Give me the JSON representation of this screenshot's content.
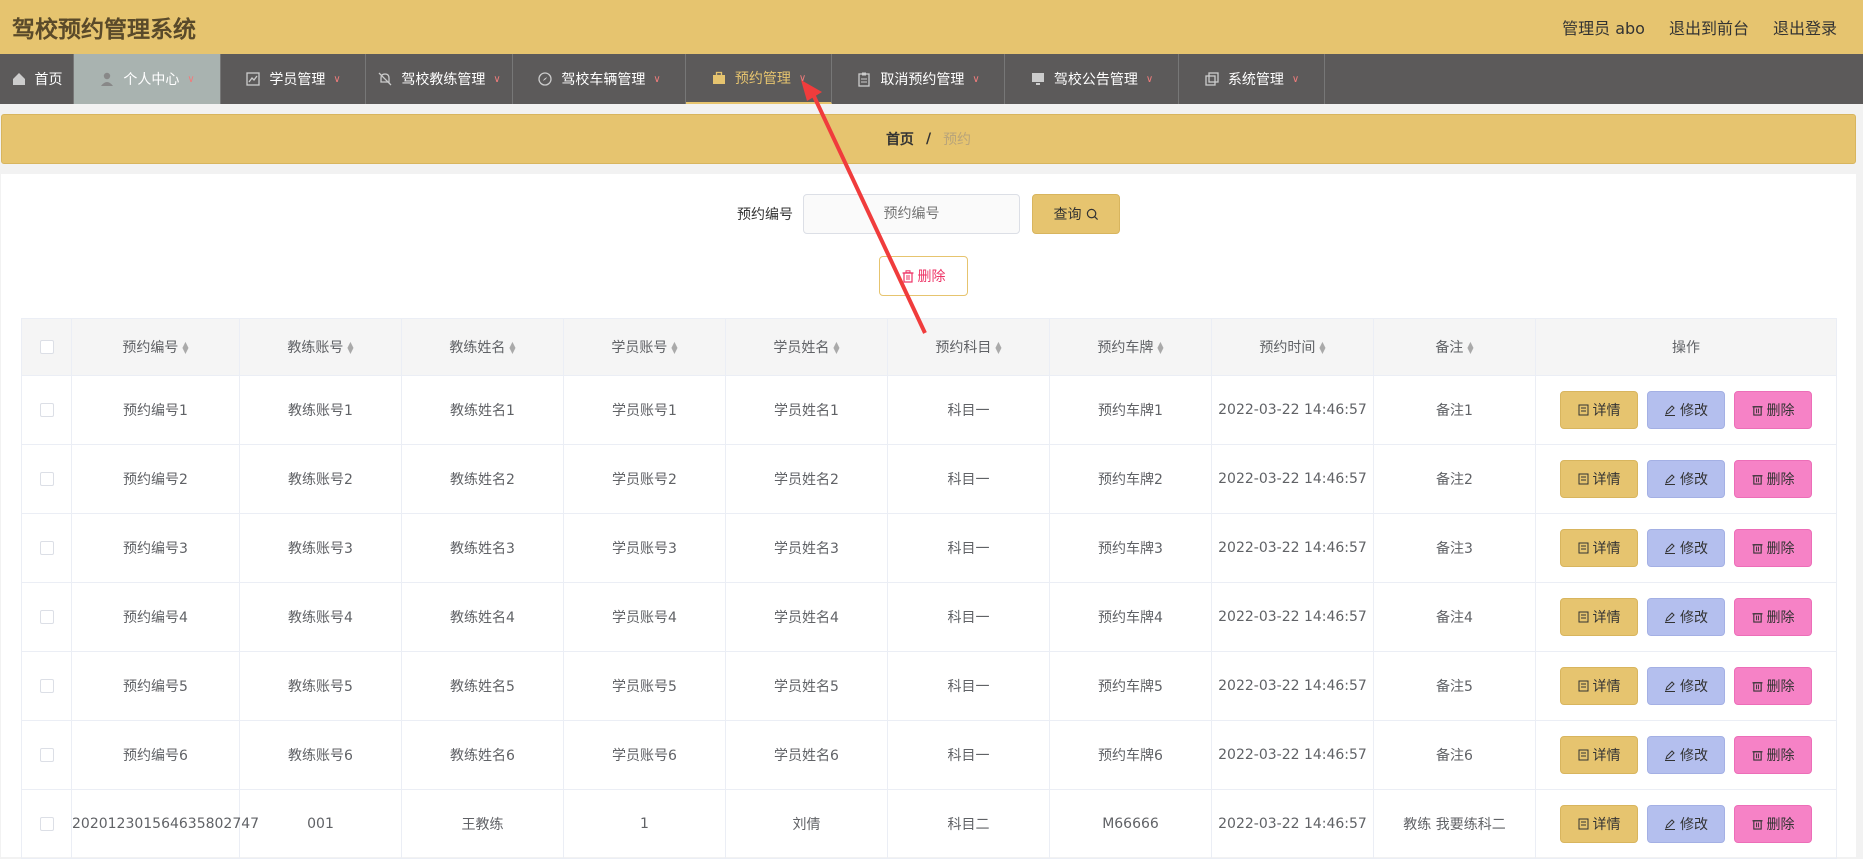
{
  "header": {
    "title": "驾校预约管理系统",
    "admin_label": "管理员 abo",
    "front_link": "退出到前台",
    "logout_link": "退出登录"
  },
  "nav": {
    "items": [
      {
        "label": "首页",
        "icon": "home-icon"
      },
      {
        "label": "个人中心",
        "icon": "user-icon"
      },
      {
        "label": "学员管理",
        "icon": "chart-icon"
      },
      {
        "label": "驾校教练管理",
        "icon": "bell-off-icon"
      },
      {
        "label": "驾校车辆管理",
        "icon": "compass-icon"
      },
      {
        "label": "预约管理",
        "icon": "briefcase-icon"
      },
      {
        "label": "取消预约管理",
        "icon": "clipboard-icon"
      },
      {
        "label": "驾校公告管理",
        "icon": "monitor-icon"
      },
      {
        "label": "系统管理",
        "icon": "copy-icon"
      }
    ],
    "active_index": 5,
    "accent": "#e6c46f"
  },
  "breadcrumb": {
    "home": "首页",
    "separator": "/",
    "current": "预约"
  },
  "search": {
    "label": "预约编号",
    "placeholder": "预约编号",
    "button": "查询"
  },
  "bulk_delete": "删除",
  "table": {
    "columns": [
      "预约编号",
      "教练账号",
      "教练姓名",
      "学员账号",
      "学员姓名",
      "预约科目",
      "预约车牌",
      "预约时间",
      "备注",
      "操作"
    ],
    "rows": [
      [
        "预约编号1",
        "教练账号1",
        "教练姓名1",
        "学员账号1",
        "学员姓名1",
        "科目一",
        "预约车牌1",
        "2022-03-22 14:46:57",
        "备注1"
      ],
      [
        "预约编号2",
        "教练账号2",
        "教练姓名2",
        "学员账号2",
        "学员姓名2",
        "科目一",
        "预约车牌2",
        "2022-03-22 14:46:57",
        "备注2"
      ],
      [
        "预约编号3",
        "教练账号3",
        "教练姓名3",
        "学员账号3",
        "学员姓名3",
        "科目一",
        "预约车牌3",
        "2022-03-22 14:46:57",
        "备注3"
      ],
      [
        "预约编号4",
        "教练账号4",
        "教练姓名4",
        "学员账号4",
        "学员姓名4",
        "科目一",
        "预约车牌4",
        "2022-03-22 14:46:57",
        "备注4"
      ],
      [
        "预约编号5",
        "教练账号5",
        "教练姓名5",
        "学员账号5",
        "学员姓名5",
        "科目一",
        "预约车牌5",
        "2022-03-22 14:46:57",
        "备注5"
      ],
      [
        "预约编号6",
        "教练账号6",
        "教练姓名6",
        "学员账号6",
        "学员姓名6",
        "科目一",
        "预约车牌6",
        "2022-03-22 14:46:57",
        "备注6"
      ],
      [
        "202012301564635802747",
        "001",
        "王教练",
        "1",
        "刘倩",
        "科目二",
        "M66666",
        "2022-03-22 14:46:57",
        "教练 我要练科二"
      ]
    ],
    "actions": {
      "detail": "详情",
      "edit": "修改",
      "delete": "删除"
    }
  }
}
